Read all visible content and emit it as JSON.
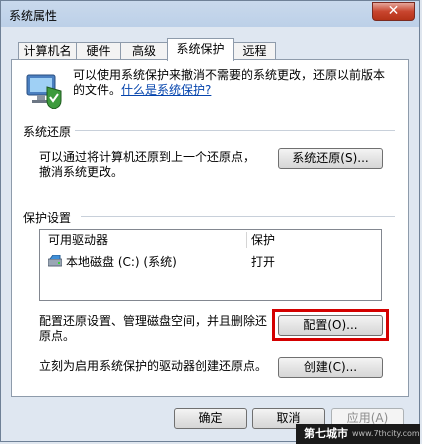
{
  "window": {
    "title": "系统属性",
    "close_glyph": "✕"
  },
  "tabs": [
    "计算机名",
    "硬件",
    "高级",
    "系统保护",
    "远程"
  ],
  "active_tab": 3,
  "intro": {
    "text": "可以使用系统保护来撤消不需要的系统更改，还原以前版本的文件。",
    "link": "什么是系统保护?"
  },
  "system_restore": {
    "heading": "系统还原",
    "description_line1": "可以通过将计算机还原到上一个还原点，",
    "description_line2": "撤消系统更改。",
    "button": "系统还原(S)..."
  },
  "protection": {
    "heading": "保护设置",
    "columns": [
      "可用驱动器",
      "保护"
    ],
    "rows": [
      {
        "drive": "本地磁盘 (C:) (系统)",
        "status": "打开"
      }
    ],
    "configure_text_line1": "配置还原设置、管理磁盘空间，并且删除还",
    "configure_text_line2": "原点。",
    "configure_button": "配置(O)...",
    "create_text": "立刻为启用系统保护的驱动器创建还原点。",
    "create_button": "创建(C)..."
  },
  "footer": {
    "ok": "确定",
    "cancel": "取消",
    "apply": "应用(A)"
  },
  "watermark": {
    "main": "第七城市",
    "sub": "www.7thcity.com"
  },
  "colors": {
    "highlight": "#d40000",
    "link": "#0645ad"
  }
}
